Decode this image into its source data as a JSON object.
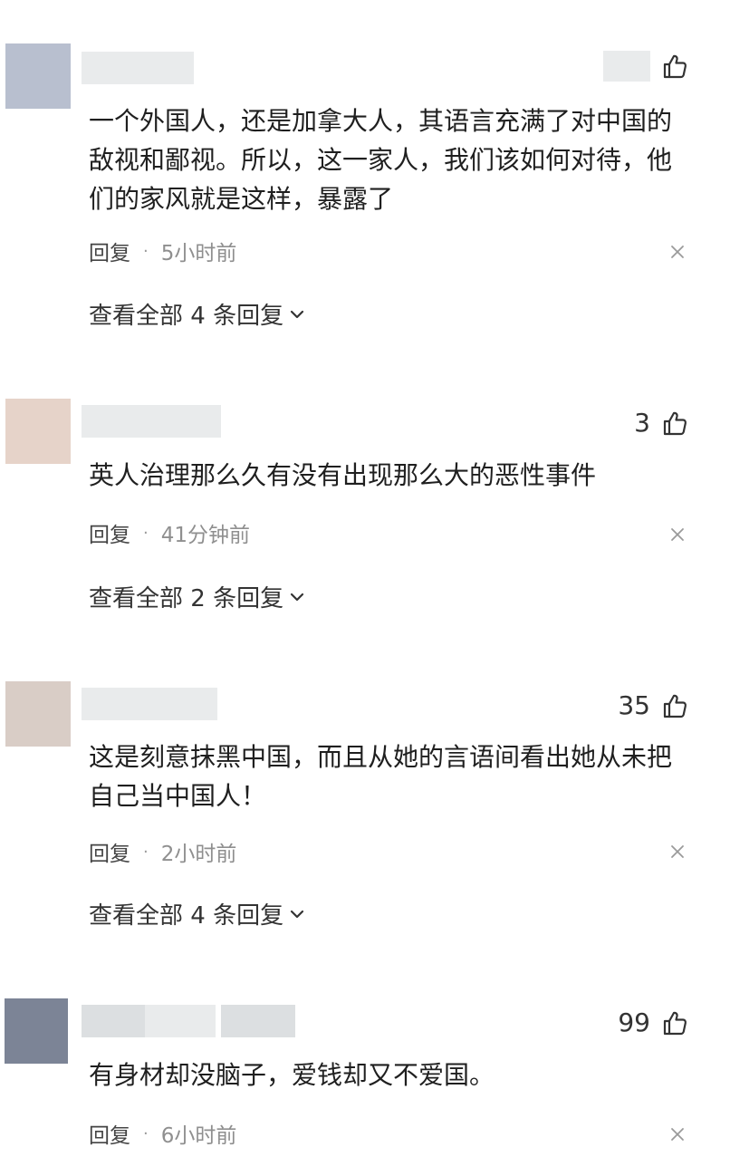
{
  "comments": [
    {
      "avatar_color": "#b8bfcf",
      "like_count": "",
      "text": "一个外国人，还是加拿大人，其语言充满了对中国的\n敌视和鄙视。所以，这一家人，我们该如何对待，他\n们的家风就是这样，暴露了",
      "reply_label": "回复",
      "dot": "·",
      "time": "5小时前",
      "view_all": "查看全部 4 条回复"
    },
    {
      "avatar_color": "#e6d3c9",
      "like_count": "3",
      "text": "英人治理那么久有没有出现那么大的恶性事件",
      "reply_label": "回复",
      "dot": "·",
      "time": "41分钟前",
      "view_all": "查看全部 2 条回复"
    },
    {
      "avatar_color": "#d9cdc6",
      "like_count": "35",
      "text": "这是刻意抹黑中国，而且从她的言语间看出她从未把\n自己当中国人！",
      "reply_label": "回复",
      "dot": "·",
      "time": "2小时前",
      "view_all": "查看全部 4 条回复"
    },
    {
      "avatar_color": "#7c8496",
      "like_count": "99",
      "text": "有身材却没脑子，爱钱却又不爱国。",
      "reply_label": "回复",
      "dot": "·",
      "time": "6小时前",
      "view_all": ""
    }
  ],
  "icons": {
    "like": "thumbs-up-icon",
    "close": "close-icon",
    "chevron": "chevron-down-icon"
  }
}
